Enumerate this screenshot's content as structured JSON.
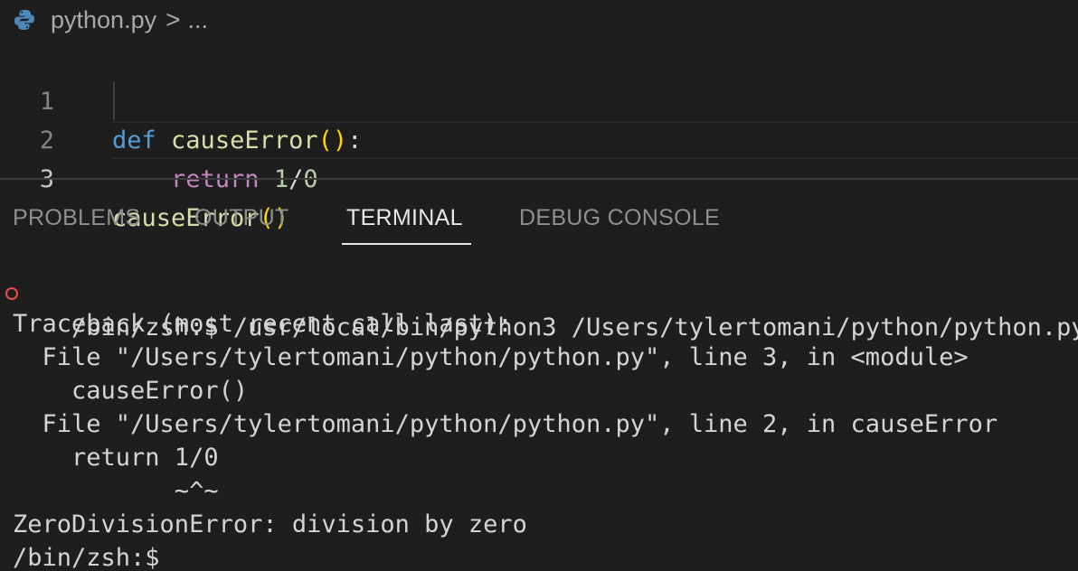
{
  "breadcrumb": {
    "file": "python.py",
    "separator": ">",
    "more": "..."
  },
  "editor": {
    "lines": [
      {
        "number": "1",
        "tokens": [
          "def",
          "causeError",
          "(",
          ")",
          ":"
        ]
      },
      {
        "number": "2",
        "tokens": [
          "return",
          "1",
          "/",
          "0"
        ]
      },
      {
        "number": "3",
        "tokens": [
          "causeError",
          "(",
          ")"
        ]
      }
    ],
    "active_line": "3"
  },
  "panel": {
    "tabs": [
      "PROBLEMS",
      "OUTPUT",
      "TERMINAL",
      "DEBUG CONSOLE"
    ],
    "active_tab": "TERMINAL"
  },
  "terminal": {
    "lines": [
      "/bin/zsh:$ /usr/local/bin/python3 /Users/tylertomani/python/python.py",
      "Traceback (most recent call last):",
      "  File \"/Users/tylertomani/python/python.py\", line 3, in <module>",
      "    causeError()",
      "  File \"/Users/tylertomani/python/python.py\", line 2, in causeError",
      "    return 1/0",
      "           ~^~",
      "ZeroDivisionError: division by zero",
      "/bin/zsh:$"
    ]
  },
  "colors": {
    "background": "#1e1e1e",
    "keyword": "#569cd6",
    "control": "#c586c0",
    "function": "#dcdcaa",
    "bracket": "#ffd700",
    "number": "#b5cea8",
    "error_marker": "#f14c4c"
  }
}
